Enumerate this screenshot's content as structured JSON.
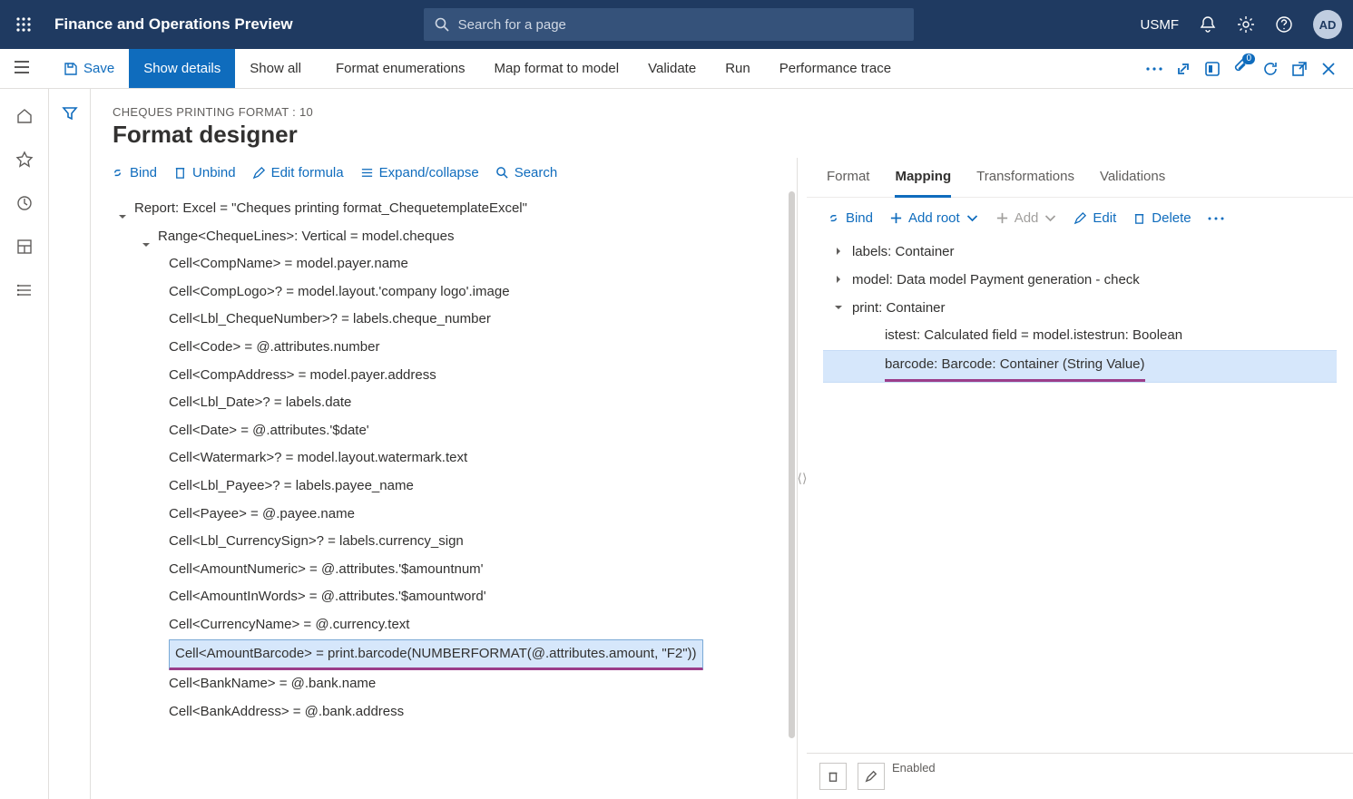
{
  "topnav": {
    "brand": "Finance and Operations Preview",
    "search_placeholder": "Search for a page",
    "company": "USMF",
    "avatar": "AD"
  },
  "actionbar": {
    "save": "Save",
    "show_details": "Show details",
    "show_all": "Show all",
    "format_enum": "Format enumerations",
    "map_format": "Map format to model",
    "validate": "Validate",
    "run": "Run",
    "perf_trace": "Performance trace",
    "badge_count": "0"
  },
  "page": {
    "breadcrumb": "CHEQUES PRINTING FORMAT : 10",
    "title": "Format designer"
  },
  "left_toolbar": {
    "bind": "Bind",
    "unbind": "Unbind",
    "edit_formula": "Edit formula",
    "expand": "Expand/collapse",
    "search": "Search"
  },
  "format_tree": {
    "root": "Report: Excel = \"Cheques printing format_ChequetemplateExcel\"",
    "range": "Range<ChequeLines>: Vertical = model.cheques",
    "cells": [
      "Cell<CompName> = model.payer.name",
      "Cell<CompLogo>? = model.layout.'company logo'.image",
      "Cell<Lbl_ChequeNumber>? = labels.cheque_number",
      "Cell<Code> = @.attributes.number",
      "Cell<CompAddress> = model.payer.address",
      "Cell<Lbl_Date>? = labels.date",
      "Cell<Date> = @.attributes.'$date'",
      "Cell<Watermark>? = model.layout.watermark.text",
      "Cell<Lbl_Payee>? = labels.payee_name",
      "Cell<Payee> = @.payee.name",
      "Cell<Lbl_CurrencySign>? = labels.currency_sign",
      "Cell<AmountNumeric> = @.attributes.'$amountnum'",
      "Cell<AmountInWords> = @.attributes.'$amountword'",
      "Cell<CurrencyName> = @.currency.text"
    ],
    "selected": "Cell<AmountBarcode> = print.barcode(NUMBERFORMAT(@.attributes.amount, \"F2\"))",
    "after": [
      "Cell<BankName> = @.bank.name",
      "Cell<BankAddress> = @.bank.address"
    ]
  },
  "right_tabs": {
    "format": "Format",
    "mapping": "Mapping",
    "transformations": "Transformations",
    "validations": "Validations"
  },
  "right_toolbar": {
    "bind": "Bind",
    "add_root": "Add root",
    "add": "Add",
    "edit": "Edit",
    "delete": "Delete"
  },
  "mapping_tree": {
    "labels": "labels: Container",
    "model": "model: Data model Payment generation - check",
    "print": "print: Container",
    "istest": "istest: Calculated field = model.istestrun: Boolean",
    "barcode": "barcode: Barcode: Container (String Value)"
  },
  "bottom": {
    "enabled": "Enabled"
  }
}
